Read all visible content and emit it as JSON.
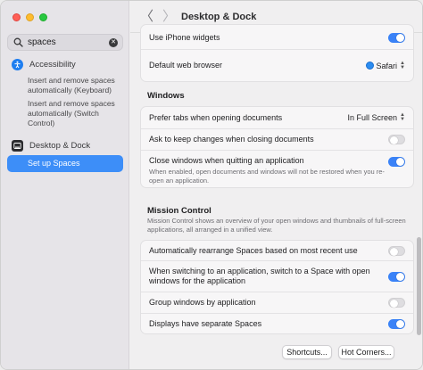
{
  "sidebar": {
    "search": {
      "value": "spaces"
    },
    "sections": [
      {
        "title": "Accessibility",
        "icon": "accessibility-icon"
      },
      {
        "title": "Desktop & Dock",
        "icon": "dock-icon"
      }
    ],
    "results": {
      "keyboard": "Insert and remove spaces automatically (Keyboard)",
      "switch_control": "Insert and remove spaces automatically (Switch Control)",
      "selected": "Set up Spaces"
    }
  },
  "header": {
    "back_glyph": "〈",
    "forward_glyph": "〉",
    "title": "Desktop & Dock"
  },
  "settings": {
    "top_group": {
      "use_iphone_widgets": {
        "label": "Use iPhone widgets",
        "on": true
      },
      "default_browser": {
        "label": "Default web browser",
        "value": "Safari"
      }
    },
    "windows": {
      "title": "Windows",
      "prefer_tabs": {
        "label": "Prefer tabs when opening documents",
        "value": "In Full Screen"
      },
      "ask_keep_changes": {
        "label": "Ask to keep changes when closing documents",
        "on": false
      },
      "close_windows": {
        "label": "Close windows when quitting an application",
        "desc": "When enabled, open documents and windows will not be restored when you re-open an application.",
        "on": true
      }
    },
    "mission_control": {
      "title": "Mission Control",
      "desc": "Mission Control shows an overview of your open windows and thumbnails of full-screen applications, all arranged in a unified view.",
      "auto_rearrange": {
        "label": "Automatically rearrange Spaces based on most recent use",
        "on": false
      },
      "switch_space": {
        "label": "When switching to an application, switch to a Space with open windows for the application",
        "on": true
      },
      "group_windows": {
        "label": "Group windows by application",
        "on": false
      },
      "separate_spaces": {
        "label": "Displays have separate Spaces",
        "on": true
      }
    }
  },
  "buttons": {
    "shortcuts": "Shortcuts...",
    "hot_corners": "Hot Corners..."
  },
  "colors": {
    "accent": "#3a82f7",
    "selection": "#3d8ef8"
  }
}
